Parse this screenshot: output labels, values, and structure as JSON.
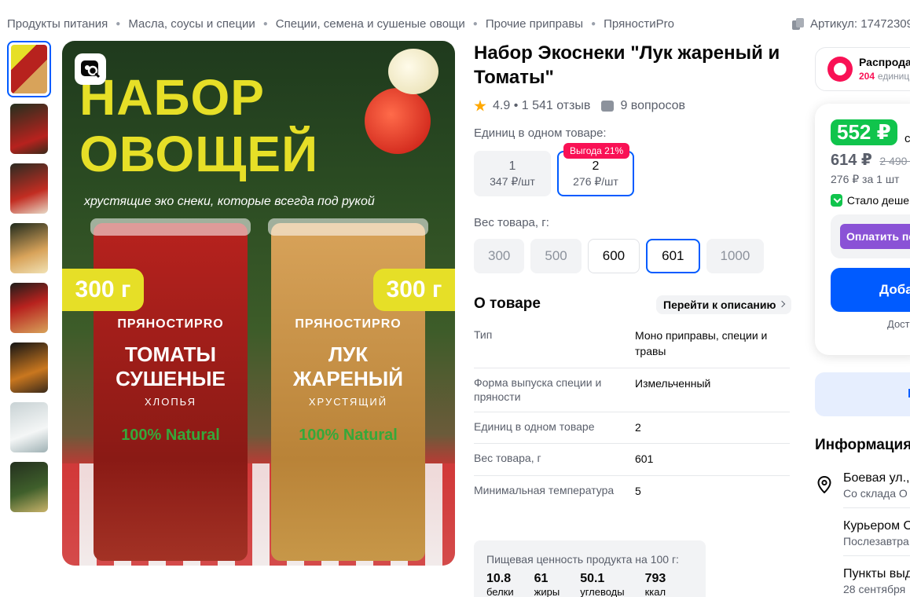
{
  "breadcrumbs": [
    "Продукты питания",
    "Масла, соусы и специи",
    "Специи, семена и сушеные овощи",
    "Прочие приправы",
    "ПряностиPro"
  ],
  "article": "Артикул: 17472309",
  "image": {
    "headline1": "НАБОР",
    "headline2": "ОВОЩЕЙ",
    "tagline": "хрустящие эко снеки, которые всегда под рукой",
    "weight_left": "300 г",
    "weight_right": "300 г",
    "jar_left": {
      "brand": "ПРЯНОСТИPRO",
      "name": "ТОМАТЫ СУШЕНЫЕ",
      "sub": "ХЛОПЬЯ",
      "natural": "100% Natural"
    },
    "jar_right": {
      "brand": "ПРЯНОСТИPRO",
      "name": "ЛУК ЖАРЕНЫЙ",
      "sub": "ХРУСТЯЩИЙ",
      "natural": "100% Natural"
    }
  },
  "product": {
    "title": "Набор Экоснеки \"Лук жареный и Томаты\"",
    "rating": "4.9 • 1 541 отзыв",
    "questions": "9 вопросов"
  },
  "units": {
    "label": "Единиц в одном товаре:",
    "options": [
      {
        "n": "1",
        "p": "347 ₽/шт"
      },
      {
        "n": "2",
        "p": "276 ₽/шт",
        "badge": "Выгода 21%"
      }
    ]
  },
  "weights": {
    "label": "Вес товара, г:",
    "options": [
      "300",
      "500",
      "600",
      "601",
      "1000"
    ]
  },
  "about": {
    "heading": "О товаре",
    "goto": "Перейти к описанию",
    "specs": [
      {
        "k": "Тип",
        "v": "Моно приправы, специи и травы"
      },
      {
        "k": "Форма выпуска специи и пряности",
        "v": "Измельченный"
      },
      {
        "k": "Единиц в одном товаре",
        "v": "2"
      },
      {
        "k": "Вес товара, г",
        "v": "601"
      },
      {
        "k": "Минимальная температура",
        "v": "5"
      }
    ]
  },
  "nutrition": {
    "title": "Пищевая ценность продукта на 100 г:",
    "items": [
      {
        "num": "10.8",
        "lab": "белки"
      },
      {
        "num": "61",
        "lab": "жиры"
      },
      {
        "num": "50.1",
        "lab": "углеводы"
      },
      {
        "num": "793",
        "lab": "ккал"
      }
    ]
  },
  "sale": {
    "title": "Распрода",
    "count": "204",
    "unit": "единиц"
  },
  "price": {
    "main": "552 ₽",
    "suffix": "с",
    "secondary": "614 ₽",
    "old": "2 490 ₽",
    "per_unit": "276 ₽ за 1 шт",
    "cheaper": "Стало деше",
    "pay": "Оплатить по",
    "add": "Доба",
    "delivery": "Дост"
  },
  "blue_box": "Н",
  "info": {
    "heading": "Информация",
    "items": [
      {
        "a": "Боевая ул.,",
        "b": "Со склада О"
      },
      {
        "a": "Курьером О",
        "b": "Послезавтра"
      },
      {
        "a": "Пункты выд",
        "b": "28 сентября"
      }
    ]
  },
  "colors": {
    "accent": "#005bff",
    "sale": "#f91155",
    "green": "#10c44c",
    "pay": "#8a52d6"
  }
}
